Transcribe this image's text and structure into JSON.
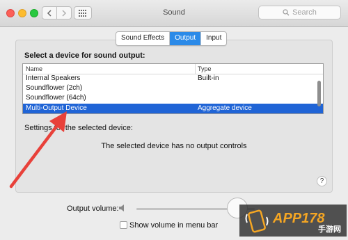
{
  "window": {
    "title": "Sound",
    "search_placeholder": "Search"
  },
  "tabs": [
    {
      "label": "Sound Effects",
      "active": false
    },
    {
      "label": "Output",
      "active": true
    },
    {
      "label": "Input",
      "active": false
    }
  ],
  "output": {
    "section_title": "Select a device for sound output:",
    "columns": {
      "name": "Name",
      "type": "Type"
    },
    "devices": [
      {
        "name": "Internal Speakers",
        "type": "Built-in",
        "selected": false
      },
      {
        "name": "Soundflower (2ch)",
        "type": "",
        "selected": false
      },
      {
        "name": "Soundflower (64ch)",
        "type": "",
        "selected": false
      },
      {
        "name": "Multi-Output Device",
        "type": "Aggregate device",
        "selected": true
      }
    ],
    "settings_label": "Settings for the selected device:",
    "no_controls_text": "The selected device has no output controls",
    "help_label": "?"
  },
  "volume": {
    "label": "Output volume:",
    "level": 0.85,
    "show_in_menu_bar_label": "Show volume in menu bar",
    "show_in_menu_bar_checked": false
  },
  "annotation": {
    "arrow_color": "#e8413a"
  },
  "watermark": {
    "text": "APP178",
    "sub": "手游网"
  },
  "colors": {
    "accent": "#2b8ae8",
    "selection": "#1f64d6"
  }
}
